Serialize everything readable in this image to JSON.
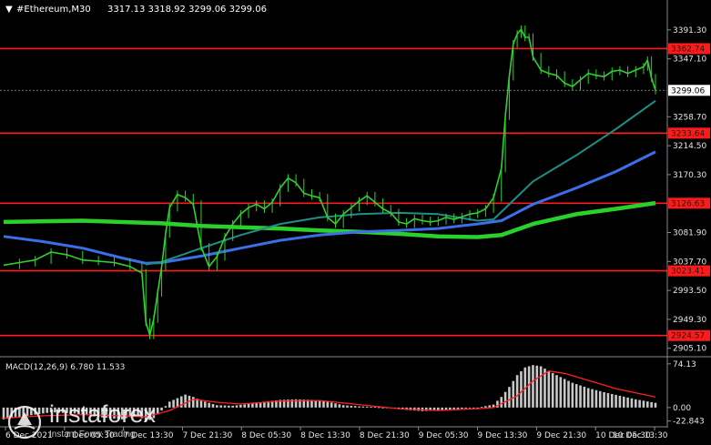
{
  "header": {
    "arrow": "▼",
    "symbol": "#Ethereum,M30",
    "ohlc": "3317.13 3318.92 3299.06 3299.06"
  },
  "macd_header": "MACD(12,26,9) 6.780 11.533",
  "watermark": {
    "name": "instaforex",
    "tagline": "Instant Forex Trading"
  },
  "colors": {
    "background": "#000000",
    "level": "#ff1a1a",
    "ma_slow": "#2ad12a",
    "ma_mid": "#3a6fe8",
    "ma_fast": "#1f8f86",
    "candles": "#2fd12f",
    "macd_hist": "#c8c8c8",
    "macd_signal": "#ff2020",
    "current_tag_bg": "#ffffff"
  },
  "chart_data": {
    "type": "line",
    "price_axis": {
      "ticks": [
        "3391.30",
        "3347.10",
        "3258.70",
        "3214.50",
        "3170.30",
        "3081.90",
        "3037.70",
        "2993.50",
        "2949.30",
        "2905.10"
      ],
      "tick_values": [
        3391.3,
        3347.1,
        3258.7,
        3214.5,
        3170.3,
        3081.9,
        3037.7,
        2993.5,
        2949.3,
        2905.1
      ],
      "range": [
        2895,
        3412
      ]
    },
    "time_axis": {
      "labels": [
        "6 Dec 2021",
        "7 Dec 05:30",
        "7 Dec 13:30",
        "7 Dec 21:30",
        "8 Dec 05:30",
        "8 Dec 13:30",
        "8 Dec 21:30",
        "9 Dec 05:30",
        "9 Dec 13:30",
        "9 Dec 21:30",
        "10 Dec 05:30",
        "10 Dec 13:30"
      ],
      "bar_range": [
        0,
        168
      ]
    },
    "levels": [
      {
        "label": "3362.74",
        "value": 3362.74
      },
      {
        "label": "3233.64",
        "value": 3233.64
      },
      {
        "label": "3126.63",
        "value": 3126.63
      },
      {
        "label": "3023.41",
        "value": 3023.41
      },
      {
        "label": "2924.57",
        "value": 2924.57
      }
    ],
    "current_price": {
      "label": "3299.06",
      "value": 3299.06
    },
    "price_series": [
      [
        0,
        3032
      ],
      [
        4,
        3036
      ],
      [
        8,
        3040
      ],
      [
        12,
        3052
      ],
      [
        16,
        3048
      ],
      [
        20,
        3040
      ],
      [
        24,
        3038
      ],
      [
        28,
        3036
      ],
      [
        32,
        3030
      ],
      [
        35,
        3020
      ],
      [
        36,
        2945
      ],
      [
        37,
        2925
      ],
      [
        38,
        2950
      ],
      [
        39,
        2990
      ],
      [
        40,
        3030
      ],
      [
        41,
        3080
      ],
      [
        42,
        3120
      ],
      [
        44,
        3140
      ],
      [
        46,
        3135
      ],
      [
        48,
        3125
      ],
      [
        50,
        3060
      ],
      [
        52,
        3030
      ],
      [
        54,
        3045
      ],
      [
        56,
        3075
      ],
      [
        58,
        3095
      ],
      [
        60,
        3110
      ],
      [
        62,
        3120
      ],
      [
        64,
        3125
      ],
      [
        66,
        3118
      ],
      [
        68,
        3128
      ],
      [
        70,
        3150
      ],
      [
        72,
        3165
      ],
      [
        74,
        3158
      ],
      [
        76,
        3142
      ],
      [
        78,
        3138
      ],
      [
        80,
        3135
      ],
      [
        82,
        3105
      ],
      [
        84,
        3095
      ],
      [
        86,
        3110
      ],
      [
        88,
        3120
      ],
      [
        90,
        3130
      ],
      [
        92,
        3138
      ],
      [
        94,
        3128
      ],
      [
        96,
        3118
      ],
      [
        98,
        3112
      ],
      [
        100,
        3098
      ],
      [
        102,
        3095
      ],
      [
        104,
        3103
      ],
      [
        106,
        3100
      ],
      [
        108,
        3098
      ],
      [
        110,
        3100
      ],
      [
        112,
        3105
      ],
      [
        114,
        3102
      ],
      [
        116,
        3106
      ],
      [
        118,
        3110
      ],
      [
        120,
        3112
      ],
      [
        122,
        3118
      ],
      [
        124,
        3135
      ],
      [
        126,
        3180
      ],
      [
        127,
        3260
      ],
      [
        128,
        3320
      ],
      [
        129,
        3370
      ],
      [
        130,
        3385
      ],
      [
        131,
        3392
      ],
      [
        132,
        3380
      ],
      [
        133,
        3380
      ],
      [
        134,
        3350
      ],
      [
        136,
        3330
      ],
      [
        138,
        3325
      ],
      [
        140,
        3322
      ],
      [
        142,
        3310
      ],
      [
        144,
        3305
      ],
      [
        146,
        3315
      ],
      [
        148,
        3325
      ],
      [
        150,
        3322
      ],
      [
        152,
        3320
      ],
      [
        154,
        3328
      ],
      [
        156,
        3330
      ],
      [
        158,
        3325
      ],
      [
        160,
        3330
      ],
      [
        162,
        3335
      ],
      [
        163,
        3345
      ],
      [
        164,
        3318
      ],
      [
        165,
        3299.06
      ]
    ],
    "ma_slow": [
      [
        0,
        3098
      ],
      [
        20,
        3100
      ],
      [
        40,
        3096
      ],
      [
        50,
        3092
      ],
      [
        60,
        3090
      ],
      [
        70,
        3088
      ],
      [
        80,
        3085
      ],
      [
        90,
        3083
      ],
      [
        100,
        3080
      ],
      [
        110,
        3076
      ],
      [
        120,
        3075
      ],
      [
        126,
        3078
      ],
      [
        134,
        3095
      ],
      [
        145,
        3110
      ],
      [
        155,
        3118
      ],
      [
        165,
        3127
      ]
    ],
    "ma_mid": [
      [
        0,
        3076
      ],
      [
        10,
        3068
      ],
      [
        20,
        3058
      ],
      [
        30,
        3043
      ],
      [
        36,
        3035
      ],
      [
        40,
        3036
      ],
      [
        50,
        3046
      ],
      [
        60,
        3058
      ],
      [
        70,
        3070
      ],
      [
        80,
        3078
      ],
      [
        90,
        3083
      ],
      [
        100,
        3085
      ],
      [
        110,
        3088
      ],
      [
        120,
        3095
      ],
      [
        126,
        3100
      ],
      [
        134,
        3125
      ],
      [
        145,
        3150
      ],
      [
        155,
        3175
      ],
      [
        165,
        3205
      ]
    ],
    "ma_fast": [
      [
        36,
        3033
      ],
      [
        40,
        3037
      ],
      [
        50,
        3058
      ],
      [
        60,
        3078
      ],
      [
        70,
        3095
      ],
      [
        80,
        3105
      ],
      [
        90,
        3110
      ],
      [
        100,
        3112
      ],
      [
        110,
        3110
      ],
      [
        120,
        3100
      ],
      [
        124,
        3102
      ],
      [
        128,
        3125
      ],
      [
        134,
        3160
      ],
      [
        145,
        3200
      ],
      [
        155,
        3240
      ],
      [
        165,
        3283
      ]
    ],
    "macd": {
      "axis_ticks": [
        "74.13",
        "0.00",
        "-22.843"
      ],
      "tick_values": [
        74.13,
        0,
        -22.843
      ],
      "range": [
        -28,
        80
      ],
      "histogram": [
        [
          0,
          -20
        ],
        [
          6,
          -14
        ],
        [
          12,
          -8
        ],
        [
          18,
          -10
        ],
        [
          24,
          -16
        ],
        [
          30,
          -20
        ],
        [
          34,
          -12
        ],
        [
          36,
          -24
        ],
        [
          38,
          -18
        ],
        [
          40,
          -5
        ],
        [
          42,
          10
        ],
        [
          44,
          16
        ],
        [
          46,
          22
        ],
        [
          48,
          18
        ],
        [
          50,
          12
        ],
        [
          54,
          4
        ],
        [
          58,
          3
        ],
        [
          62,
          6
        ],
        [
          66,
          10
        ],
        [
          70,
          13
        ],
        [
          74,
          14
        ],
        [
          78,
          13
        ],
        [
          82,
          10
        ],
        [
          86,
          4
        ],
        [
          90,
          2
        ],
        [
          94,
          1
        ],
        [
          98,
          -1
        ],
        [
          102,
          -4
        ],
        [
          106,
          -6
        ],
        [
          110,
          -5
        ],
        [
          114,
          -3
        ],
        [
          118,
          -1
        ],
        [
          120,
          0
        ],
        [
          124,
          5
        ],
        [
          126,
          18
        ],
        [
          128,
          35
        ],
        [
          130,
          55
        ],
        [
          132,
          68
        ],
        [
          134,
          72
        ],
        [
          136,
          70
        ],
        [
          138,
          62
        ],
        [
          140,
          55
        ],
        [
          144,
          42
        ],
        [
          148,
          33
        ],
        [
          152,
          26
        ],
        [
          156,
          20
        ],
        [
          160,
          14
        ],
        [
          165,
          8
        ]
      ],
      "signal": [
        [
          0,
          -18
        ],
        [
          10,
          -14
        ],
        [
          20,
          -12
        ],
        [
          30,
          -14
        ],
        [
          36,
          -16
        ],
        [
          42,
          -5
        ],
        [
          48,
          14
        ],
        [
          54,
          9
        ],
        [
          60,
          6
        ],
        [
          70,
          11
        ],
        [
          80,
          12
        ],
        [
          90,
          5
        ],
        [
          100,
          -2
        ],
        [
          110,
          -5
        ],
        [
          120,
          -2
        ],
        [
          124,
          0
        ],
        [
          130,
          20
        ],
        [
          134,
          45
        ],
        [
          138,
          62
        ],
        [
          142,
          58
        ],
        [
          148,
          46
        ],
        [
          155,
          32
        ],
        [
          165,
          18
        ]
      ]
    }
  }
}
